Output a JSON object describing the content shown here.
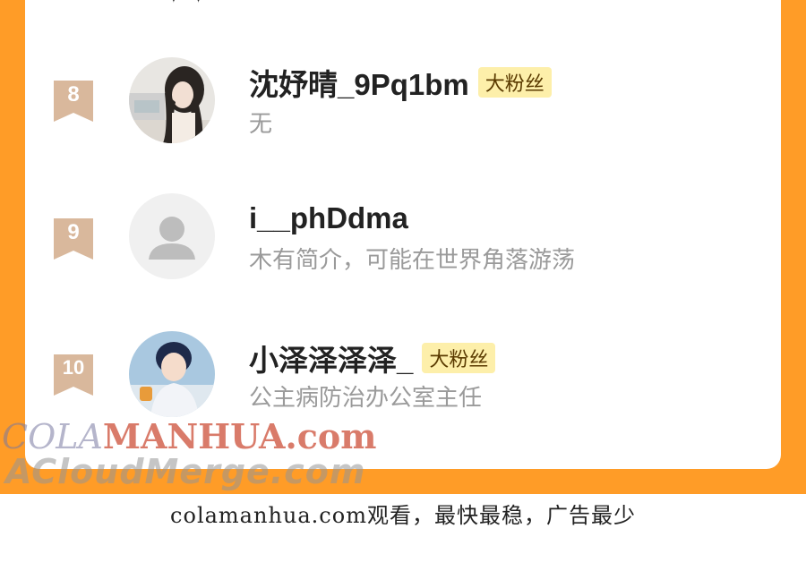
{
  "list": {
    "entries": [
      {
        "rank": "8",
        "name": "沈妤晴_9Pq1bm",
        "badge": "大粉丝",
        "bio": "无",
        "avatar": "photo-avatar-girl"
      },
      {
        "rank": "9",
        "name": "i__phDdma",
        "badge": "",
        "bio": "木有简介，可能在世界角落游荡",
        "avatar": "default-user-icon"
      },
      {
        "rank": "10",
        "name": "小泽泽泽泽_",
        "badge": "大粉丝",
        "bio": "公主病防治办公室主任",
        "avatar": "photo-avatar-anime"
      }
    ]
  },
  "watermark": {
    "line1_part1": "COLA",
    "line1_part2": "MANHUA.com",
    "line2": "ACloudMerge.com"
  },
  "footer": {
    "text": "colamanhua.com观看，最快最稳，广告最少"
  },
  "colors": {
    "frame": "#ff9c27",
    "badge_bg": "#fdefaa",
    "rank_ribbon": "#d9b89c"
  }
}
